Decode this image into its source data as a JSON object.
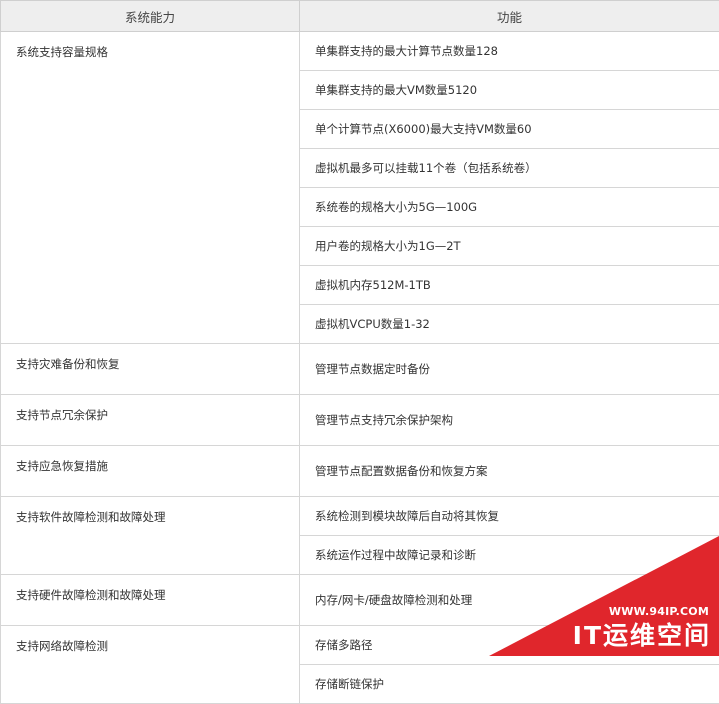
{
  "table": {
    "headers": [
      "系统能力",
      "功能"
    ],
    "groups": [
      {
        "capability": "系统支持容量规格",
        "functions": [
          "单集群支持的最大计算节点数量128",
          "单集群支持的最大VM数量5120",
          "单个计算节点(X6000)最大支持VM数量60",
          "虚拟机最多可以挂载11个卷（包括系统卷）",
          "系统卷的规格大小为5G—100G",
          "用户卷的规格大小为1G—2T",
          "虚拟机内存512M-1TB",
          "虚拟机VCPU数量1-32"
        ]
      },
      {
        "capability": "支持灾难备份和恢复",
        "functions": [
          "管理节点数据定时备份"
        ]
      },
      {
        "capability": "支持节点冗余保护",
        "functions": [
          "管理节点支持冗余保护架构"
        ]
      },
      {
        "capability": "支持应急恢复措施",
        "functions": [
          "管理节点配置数据备份和恢复方案"
        ]
      },
      {
        "capability": "支持软件故障检测和故障处理",
        "functions": [
          "系统检测到模块故障后自动将其恢复",
          "系统运作过程中故障记录和诊断"
        ]
      },
      {
        "capability": "支持硬件故障检测和故障处理",
        "functions": [
          "内存/网卡/硬盘故障检测和处理"
        ]
      },
      {
        "capability": "支持网络故障检测",
        "functions": [
          "存储多路径",
          "存储断链保护"
        ]
      }
    ]
  },
  "watermark": {
    "url": "WWW.94IP.COM",
    "brand": "IT运维空间",
    "color": "#e0262c"
  }
}
